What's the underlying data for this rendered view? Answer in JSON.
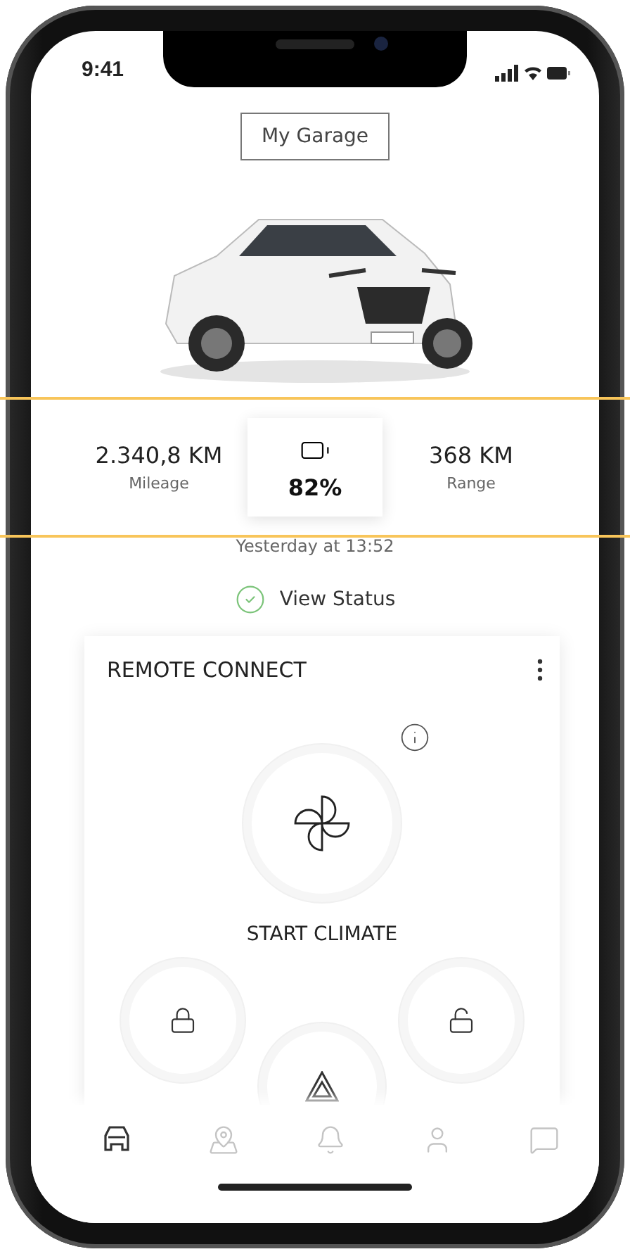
{
  "status_bar": {
    "time": "9:41"
  },
  "header": {
    "button": "My Garage"
  },
  "stats": [
    {
      "kind": "distance",
      "value": "2.340,8 KM",
      "label": "Mileage"
    },
    {
      "kind": "battery",
      "value": "82%"
    },
    {
      "kind": "distance",
      "value": "368 KM",
      "label": "Range"
    }
  ],
  "last_updated": "Yesterday at 13:52",
  "status_link": {
    "label": "View Status",
    "ok": true
  },
  "remote_connect": {
    "title": "REMOTE CONNECT",
    "climate_label": "START CLIMATE",
    "actions": [
      {
        "kind": "lock"
      },
      {
        "kind": "hazard"
      },
      {
        "kind": "unlock"
      }
    ]
  },
  "nav": [
    {
      "kind": "car",
      "selected": true
    },
    {
      "kind": "map",
      "selected": false
    },
    {
      "kind": "bell",
      "selected": false
    },
    {
      "kind": "user",
      "selected": false
    },
    {
      "kind": "chat",
      "selected": false
    }
  ]
}
